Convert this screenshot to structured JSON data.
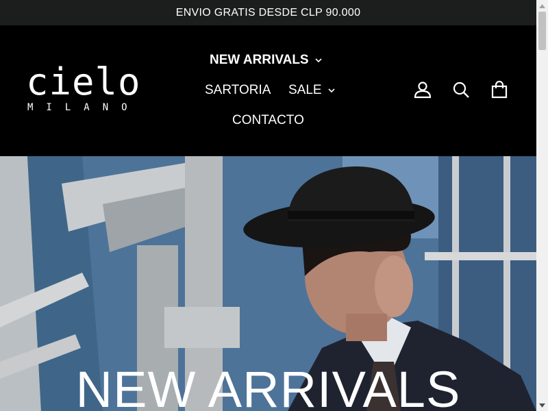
{
  "announcement": {
    "text": "ENVIO GRATIS DESDE CLP 90.000"
  },
  "logo": {
    "word": "cielo",
    "sub": "MILANO"
  },
  "nav": {
    "items": [
      {
        "label": "NEW ARRIVALS",
        "has_dropdown": true,
        "active": true
      },
      {
        "label": "SARTORIA",
        "has_dropdown": false
      },
      {
        "label": "SALE",
        "has_dropdown": true
      },
      {
        "label": "CONTACTO",
        "has_dropdown": false
      }
    ]
  },
  "header_icons": [
    "user-icon",
    "search-icon",
    "cart-icon"
  ],
  "hero": {
    "title": "NEW ARRIVALS"
  },
  "colors": {
    "announcement_bg": "#1c1d1d",
    "header_bg": "#000000",
    "text": "#ffffff"
  }
}
